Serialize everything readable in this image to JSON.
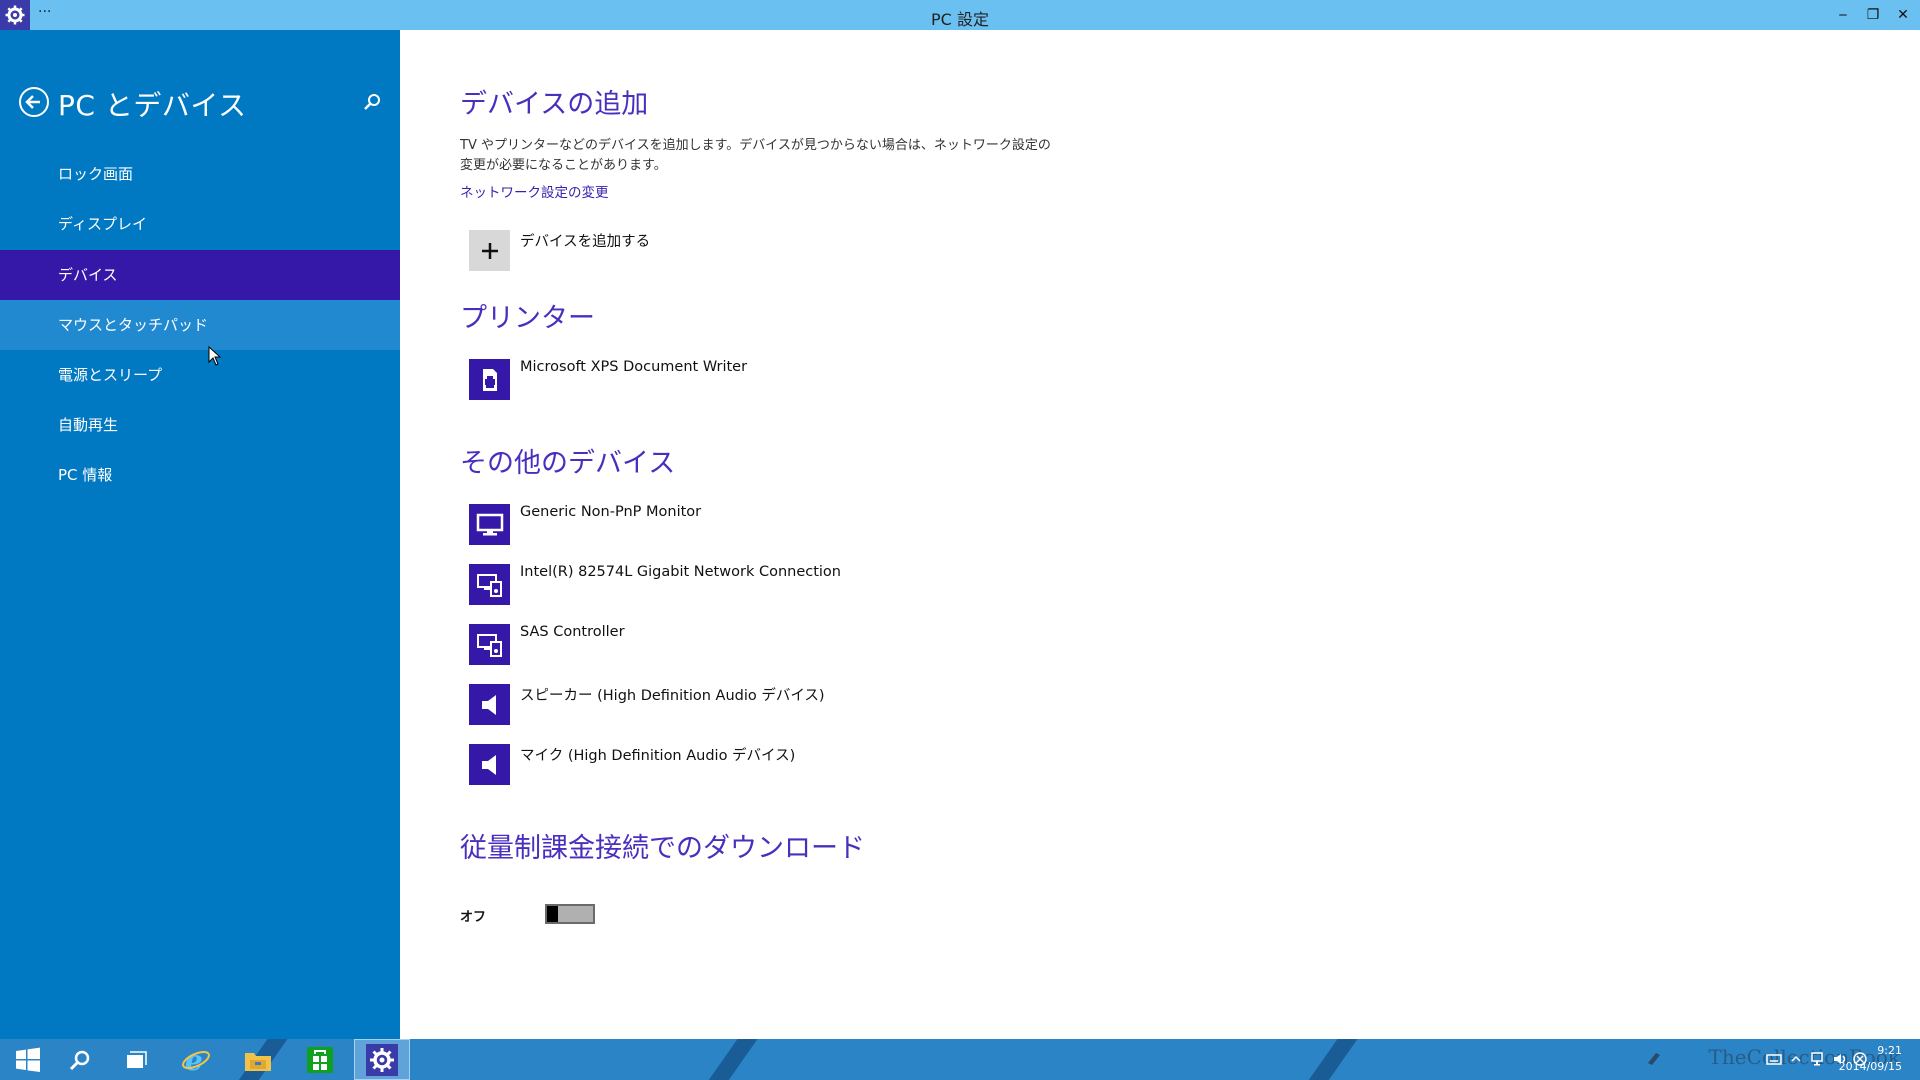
{
  "window": {
    "title": "PC 設定",
    "menu_dots": "···",
    "minimize": "‒",
    "restore": "❐",
    "close": "✕"
  },
  "sidebar": {
    "title": "PC とデバイス",
    "items": [
      {
        "label": "ロック画面"
      },
      {
        "label": "ディスプレイ"
      },
      {
        "label": "デバイス"
      },
      {
        "label": "マウスとタッチパッド"
      },
      {
        "label": "電源とスリープ"
      },
      {
        "label": "自動再生"
      },
      {
        "label": "PC 情報"
      }
    ],
    "selected": "デバイス",
    "hovered": "マウスとタッチパッド"
  },
  "main": {
    "add_devices": {
      "heading": "デバイスの追加",
      "description": "TV やプリンターなどのデバイスを追加します。デバイスが見つからない場合は、ネットワーク設定の変更が必要になることがあります。",
      "link": "ネットワーク設定の変更",
      "add_button": "デバイスを追加する"
    },
    "printers": {
      "heading": "プリンター",
      "items": [
        {
          "label": "Microsoft XPS Document Writer",
          "icon": "printer-icon"
        }
      ]
    },
    "other_devices": {
      "heading": "その他のデバイス",
      "items": [
        {
          "label": "Generic Non-PnP Monitor",
          "icon": "monitor-icon"
        },
        {
          "label": "Intel(R) 82574L Gigabit Network Connection",
          "icon": "device-icon"
        },
        {
          "label": "SAS Controller",
          "icon": "device-icon"
        },
        {
          "label": "スピーカー (High Definition Audio デバイス)",
          "icon": "speaker-icon"
        },
        {
          "label": "マイク (High Definition Audio デバイス)",
          "icon": "speaker-icon"
        }
      ]
    },
    "metered": {
      "heading": "従量制課金接続でのダウンロード",
      "toggle_label": "オフ",
      "toggle_on": false
    }
  },
  "taskbar": {
    "apps": [
      "start-icon",
      "search-icon",
      "task-view-icon",
      "internet-explorer-icon",
      "file-explorer-icon",
      "store-icon",
      "settings-icon"
    ],
    "active_app": "settings-icon",
    "clock_time": "9:21",
    "clock_date": "2014/09/15",
    "watermark": "TheCollectionBook"
  },
  "colors": {
    "titlebar": "#6ac0f0",
    "sidebar": "#0079c2",
    "selected": "#3618a8",
    "accent_text": "#4a2fbf",
    "taskbar": "#2b84c6"
  }
}
